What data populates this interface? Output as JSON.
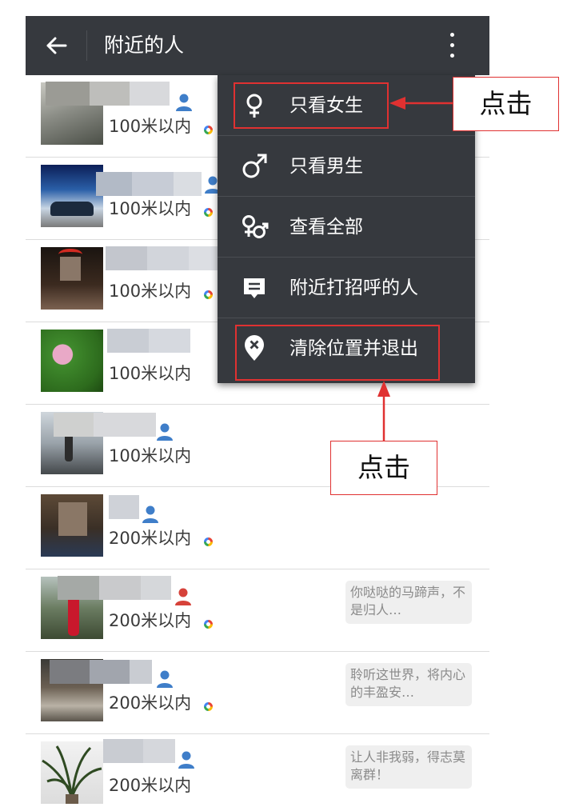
{
  "header": {
    "title": "附近的人"
  },
  "menu": {
    "items": [
      {
        "label": "只看女生",
        "icon": "female-icon"
      },
      {
        "label": "只看男生",
        "icon": "male-icon"
      },
      {
        "label": "查看全部",
        "icon": "all-genders-icon"
      },
      {
        "label": "附近打招呼的人",
        "icon": "greeting-message-icon"
      },
      {
        "label": "清除位置并退出",
        "icon": "clear-location-icon"
      }
    ]
  },
  "people": [
    {
      "distance": "100米以内",
      "gender": "male",
      "signature": ""
    },
    {
      "distance": "100米以内",
      "gender": "male",
      "signature": ""
    },
    {
      "distance": "100米以内",
      "gender": "male",
      "signature": ""
    },
    {
      "distance": "100米以内",
      "gender": "male",
      "signature": ""
    },
    {
      "distance": "100米以内",
      "gender": "male",
      "signature": ""
    },
    {
      "distance": "200米以内",
      "gender": "male",
      "signature": ""
    },
    {
      "distance": "200米以内",
      "gender": "female",
      "signature": "你哒哒的马蹄声，不是归人…"
    },
    {
      "distance": "200米以内",
      "gender": "male",
      "signature": "聆听这世界，将内心的丰盈安…"
    },
    {
      "distance": "200米以内",
      "gender": "male",
      "signature": "让人非我弱，得志莫离群！"
    }
  ],
  "annotations": {
    "top": {
      "text": "点击"
    },
    "bottom": {
      "text": "点击"
    }
  },
  "colors": {
    "toolbar": "#36393e",
    "menu": "#36393e",
    "highlight": "#e03131",
    "male_badge": "#3f7ec9",
    "female_badge": "#d6423a"
  }
}
